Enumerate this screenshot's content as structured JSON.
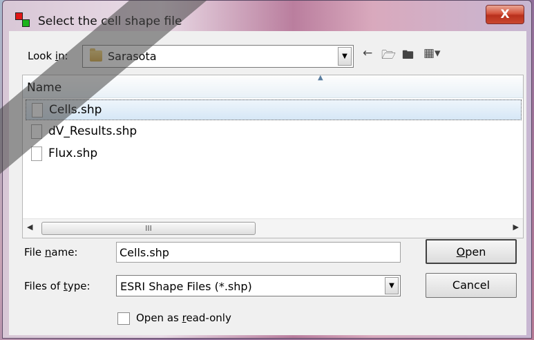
{
  "window": {
    "title": "Select the cell shape file",
    "close_label": "X"
  },
  "lookin": {
    "label_pre": "Look ",
    "label_ul": "i",
    "label_post": "n:",
    "value": "Sarasota"
  },
  "toolbar": {
    "back_icon": "back-arrow-icon",
    "up_icon": "up-folder-icon",
    "new_folder_icon": "new-folder-icon",
    "view_icon": "view-menu-icon"
  },
  "filelist": {
    "column": "Name",
    "files": [
      "Cells.shp",
      "dV_Results.shp",
      "Flux.shp"
    ],
    "selected_index": 0,
    "scroll_thumb": "III"
  },
  "filename": {
    "label_pre": "File ",
    "label_ul": "n",
    "label_post": "ame:",
    "value": "Cells.shp"
  },
  "filetype": {
    "label_pre": "Files of ",
    "label_ul": "t",
    "label_post": "ype:",
    "value": "ESRI Shape Files (*.shp)"
  },
  "readonly": {
    "label_pre": "Open as ",
    "label_ul": "r",
    "label_post": "ead-only",
    "checked": false
  },
  "buttons": {
    "open_ul": "O",
    "open_post": "pen",
    "cancel": "Cancel"
  }
}
